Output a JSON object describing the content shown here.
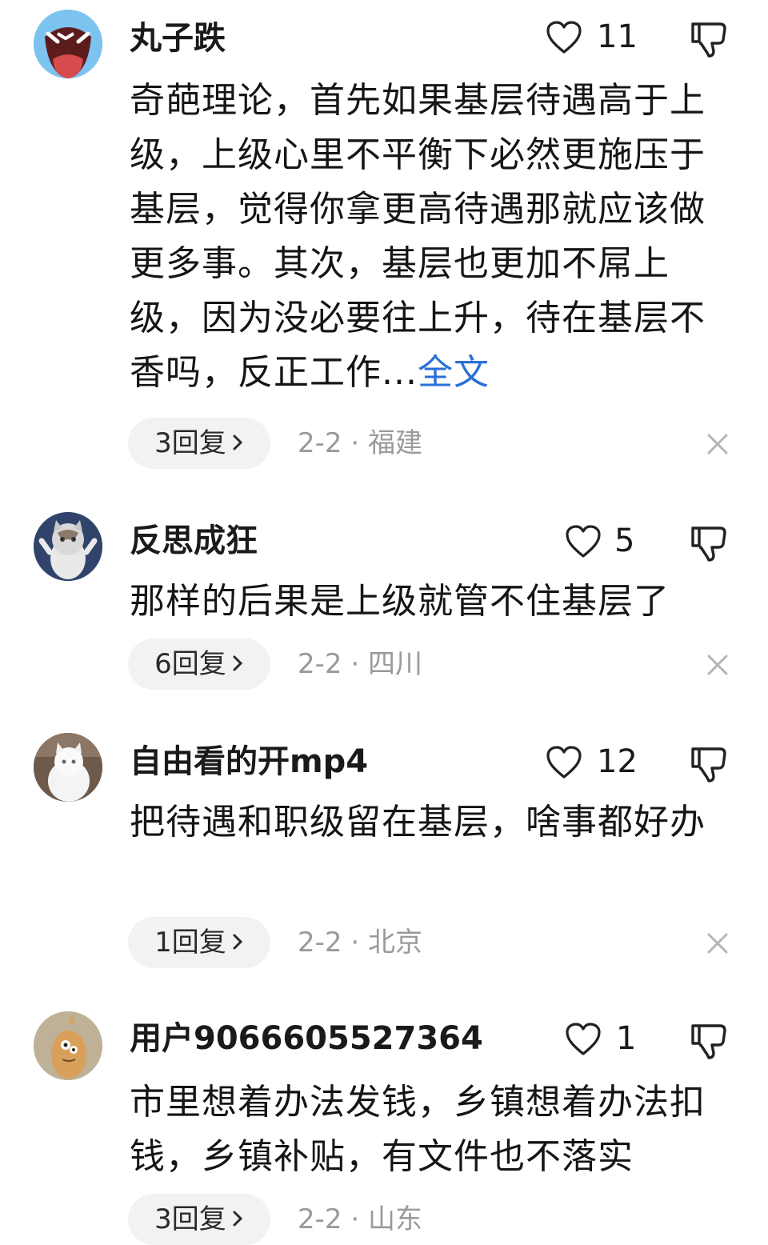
{
  "comments": [
    {
      "username": "丸子跌",
      "likes": "11",
      "text": "奇葩理论，首先如果基层待遇高于上级，上级心里不平衡下必然更施压于基层，觉得你拿更高待遇那就应该做更多事。其次，基层也更加不屌上级，因为没必要往上升，待在基层不香吗，反正工作...",
      "more_label": "全文",
      "reply_label": "3回复",
      "meta": "2-2 · 福建",
      "avatar_icon": "crying-face-avatar"
    },
    {
      "username": "反思成狂",
      "likes": "5",
      "text": "那样的后果是上级就管不住基层了",
      "reply_label": "6回复",
      "meta": "2-2 · 四川",
      "avatar_icon": "cat-avatar"
    },
    {
      "username": "自由看的开mp4",
      "likes": "12",
      "text": "把待遇和职级留在基层，啥事都好办",
      "reply_label": "1回复",
      "meta": "2-2 · 北京",
      "avatar_icon": "white-cat-avatar"
    },
    {
      "username": "用户9066605527364",
      "likes": "1",
      "text": "市里想着办法发钱，乡镇想着办法扣钱，乡镇补贴，有文件也不落实",
      "reply_label": "3回复",
      "meta": "2-2 · 山东",
      "avatar_icon": "cartoon-character-avatar"
    }
  ],
  "icons": {
    "like": "heart-outline-icon",
    "dislike": "thumbs-down-icon",
    "close": "close-icon",
    "chevron": "chevron-right-icon"
  },
  "colors": {
    "link": "#2a6fd8",
    "meta": "#9a9a9a",
    "pill_bg": "#f2f2f2"
  }
}
